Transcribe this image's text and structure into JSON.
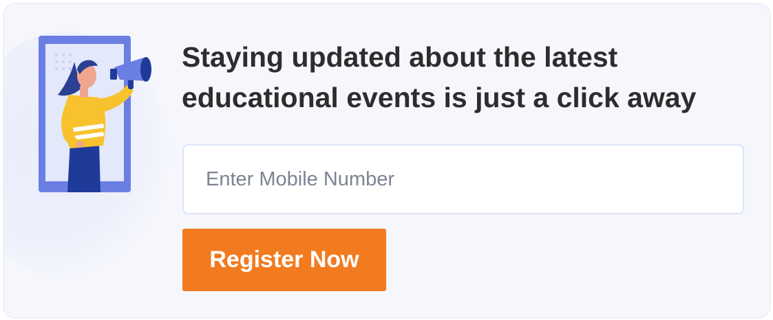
{
  "banner": {
    "headline_line1": "Staying updated about the latest",
    "headline_line2": "educational events is just a click away",
    "mobile_input_placeholder": "Enter Mobile Number",
    "mobile_input_value": "",
    "register_label": "Register Now",
    "illustration": "woman-with-megaphone-illustration"
  },
  "colors": {
    "card_background": "#f6f7fd",
    "button_background": "#f27b20",
    "phone_frame": "#6b7fe3",
    "shirt": "#f7c22d",
    "hair": "#2b3f93",
    "pants": "#1f3b9a"
  }
}
